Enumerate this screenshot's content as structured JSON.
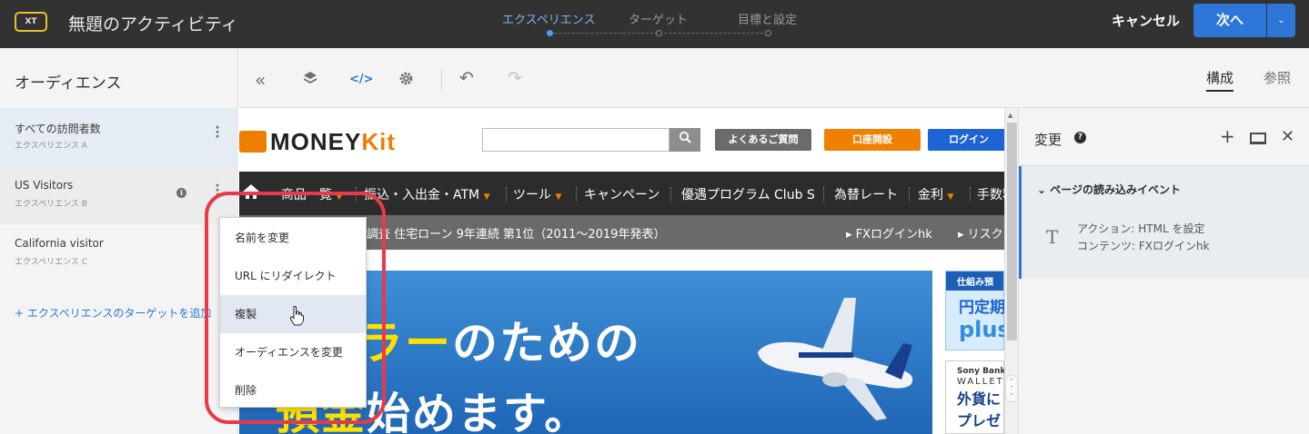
{
  "header": {
    "logo": "XT",
    "title": "無題のアクティビティ",
    "steps": [
      "エクスペリエンス",
      "ターゲット",
      "目標と設定"
    ],
    "cancel": "キャンセル",
    "next": "次へ",
    "next_caret": "⌄"
  },
  "left": {
    "title": "オーディエンス",
    "experiences": [
      {
        "name": "すべての訪問者数",
        "sub": "エクスペリエンス A"
      },
      {
        "name": "US Visitors",
        "sub": "エクスペリエンス B"
      },
      {
        "name": "California visitor",
        "sub": "エクスペリエンス C"
      }
    ],
    "add_link": "+ エクスペリエンスのターゲットを追加"
  },
  "toolbar": {
    "collapse": "«",
    "code": "</>",
    "undo": "↶",
    "redo": "↷",
    "tab_compose": "構成",
    "tab_reference": "参照"
  },
  "site": {
    "logo_text": "MONEY",
    "logo_accent": "Kit",
    "search_icon": "🔍",
    "faq": "よくあるご質問",
    "open_account": "口座開設",
    "login": "ログイン",
    "nav": [
      "商品一覧",
      "振込・入出金・ATM",
      "ツール",
      "キャンペーン",
      "優遇プログラム Club S",
      "為替レート",
      "金利",
      "手数料"
    ],
    "news": "調査 住宅ローン 9年連続 第1位（2011〜2019年発表）",
    "news_links": [
      "FXログインhk",
      "リスク"
    ],
    "hero_line1_yellow": "ラー",
    "hero_line1_white": "のための",
    "hero_line2_yellow": "預金",
    "hero_line2_white": "始めます。",
    "side1_head": "仕組み預",
    "side1_t1": "円定期",
    "side1_t2": "plus",
    "side2_a": "Sony Bank",
    "side2_b": "WALLET",
    "side2_c1": "外貨に",
    "side2_c2": "プレゼ"
  },
  "right": {
    "title": "変更",
    "help": "?",
    "plus": "+",
    "close": "✕",
    "event_title": "ページの読み込みイベント",
    "action_icon": "T",
    "action": "アクション: HTML を設定",
    "content": "コンテンツ: FXログインhk"
  },
  "menu": {
    "items": [
      "名前を変更",
      "URL にリダイレクト",
      "複製",
      "オーディエンスを変更",
      "削除"
    ]
  }
}
